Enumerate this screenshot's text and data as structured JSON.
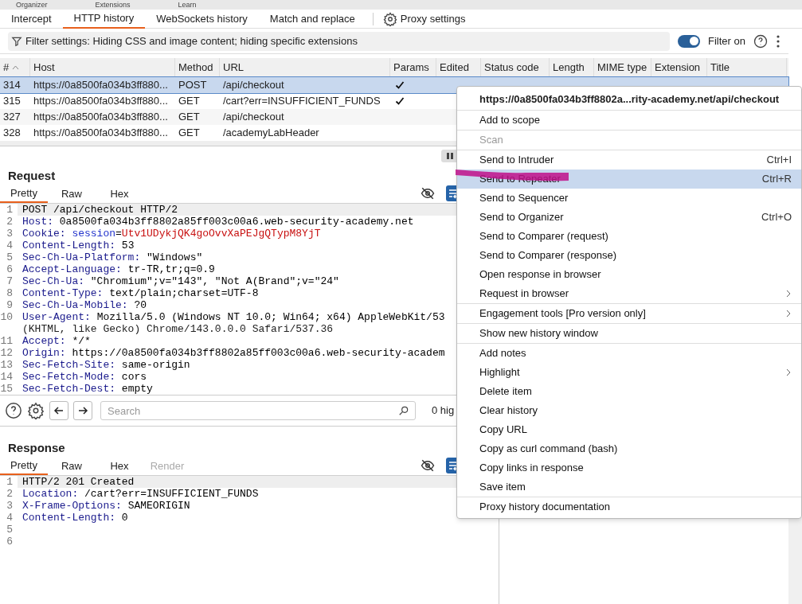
{
  "top_menu": [
    "Organizer",
    "Extensions",
    "Learn"
  ],
  "proxy_tabs": [
    {
      "label": "Intercept",
      "selected": false
    },
    {
      "label": "HTTP history",
      "selected": true
    },
    {
      "label": "WebSockets history",
      "selected": false
    },
    {
      "label": "Match and replace",
      "selected": false
    }
  ],
  "proxy_settings": "Proxy settings",
  "filter": {
    "text": "Filter settings: Hiding CSS and image content; hiding specific extensions",
    "toggle_label": "Filter on",
    "on": true
  },
  "table": {
    "columns": [
      "#",
      "Host",
      "Method",
      "URL",
      "Params",
      "Edited",
      "Status code",
      "Length",
      "MIME type",
      "Extension",
      "Title"
    ],
    "rows": [
      {
        "cells": [
          "314",
          "https://0a8500fa034b3ff880...",
          "POST",
          "/api/checkout"
        ],
        "params": true,
        "selected": true
      },
      {
        "cells": [
          "315",
          "https://0a8500fa034b3ff880...",
          "GET",
          "/cart?err=INSUFFICIENT_FUNDS"
        ],
        "params": true,
        "selected": false
      },
      {
        "cells": [
          "327",
          "https://0a8500fa034b3ff880...",
          "GET",
          "/api/checkout"
        ],
        "params": false,
        "selected": false
      },
      {
        "cells": [
          "328",
          "https://0a8500fa034b3ff880...",
          "GET",
          "/academyLabHeader"
        ],
        "params": false,
        "selected": false
      }
    ]
  },
  "request": {
    "title": "Request",
    "tabs": [
      {
        "label": "Pretty",
        "selected": true
      },
      {
        "label": "Raw",
        "selected": false
      },
      {
        "label": "Hex",
        "selected": false
      }
    ],
    "lines": [
      {
        "no": "1",
        "parts": [
          {
            "kind": "plain",
            "text": "POST /api/checkout HTTP/2"
          }
        ]
      },
      {
        "no": "2",
        "parts": [
          {
            "kind": "name",
            "text": "Host:"
          },
          {
            "kind": "plain",
            "text": " 0a8500fa034b3ff8802a85ff003c00a6.web-security-academy.net"
          }
        ]
      },
      {
        "no": "3",
        "parts": [
          {
            "kind": "name",
            "text": "Cookie:"
          },
          {
            "kind": "cookie-name",
            "text": " session"
          },
          {
            "kind": "plain",
            "text": "="
          },
          {
            "kind": "cookie-value",
            "text": "Utv1UDykjQK4goOvvXaPEJgQTypM8YjT"
          }
        ]
      },
      {
        "no": "4",
        "parts": [
          {
            "kind": "name",
            "text": "Content-Length:"
          },
          {
            "kind": "plain",
            "text": " 53"
          }
        ]
      },
      {
        "no": "5",
        "parts": [
          {
            "kind": "name",
            "text": "Sec-Ch-Ua-Platform:"
          },
          {
            "kind": "plain",
            "text": " \"Windows\""
          }
        ]
      },
      {
        "no": "6",
        "parts": [
          {
            "kind": "name",
            "text": "Accept-Language:"
          },
          {
            "kind": "plain",
            "text": " tr-TR,tr;q=0.9"
          }
        ]
      },
      {
        "no": "7",
        "parts": [
          {
            "kind": "name",
            "text": "Sec-Ch-Ua:"
          },
          {
            "kind": "plain",
            "text": " \"Chromium\";v=\"143\", \"Not A(Brand\";v=\"24\""
          }
        ]
      },
      {
        "no": "8",
        "parts": [
          {
            "kind": "name",
            "text": "Content-Type:"
          },
          {
            "kind": "plain",
            "text": " text/plain;charset=UTF-8"
          }
        ]
      },
      {
        "no": "9",
        "parts": [
          {
            "kind": "name",
            "text": "Sec-Ch-Ua-Mobile:"
          },
          {
            "kind": "plain",
            "text": " ?0"
          }
        ]
      },
      {
        "no": "10",
        "parts": [
          {
            "kind": "name",
            "text": "User-Agent:"
          },
          {
            "kind": "plain",
            "text": " Mozilla/5.0 (Windows NT 10.0; Win64; x64) AppleWebKit/53"
          }
        ],
        "continuation": "(KHTML, like Gecko) Chrome/143.0.0.0 Safari/537.36"
      },
      {
        "no": "11",
        "parts": [
          {
            "kind": "name",
            "text": "Accept:"
          },
          {
            "kind": "plain",
            "text": " */*"
          }
        ]
      },
      {
        "no": "12",
        "parts": [
          {
            "kind": "name",
            "text": "Origin:"
          },
          {
            "kind": "plain",
            "text": " https://0a8500fa034b3ff8802a85ff003c00a6.web-security-academ"
          }
        ]
      },
      {
        "no": "13",
        "parts": [
          {
            "kind": "name",
            "text": "Sec-Fetch-Site:"
          },
          {
            "kind": "plain",
            "text": " same-origin"
          }
        ]
      },
      {
        "no": "14",
        "parts": [
          {
            "kind": "name",
            "text": "Sec-Fetch-Mode:"
          },
          {
            "kind": "plain",
            "text": " cors"
          }
        ]
      },
      {
        "no": "15",
        "parts": [
          {
            "kind": "name",
            "text": "Sec-Fetch-Dest:"
          },
          {
            "kind": "plain",
            "text": " empty"
          }
        ]
      }
    ]
  },
  "search": {
    "placeholder": "Search",
    "highlights": "0 hig"
  },
  "response": {
    "title": "Response",
    "tabs": [
      {
        "label": "Pretty",
        "selected": true,
        "disabled": false
      },
      {
        "label": "Raw",
        "selected": false,
        "disabled": false
      },
      {
        "label": "Hex",
        "selected": false,
        "disabled": false
      },
      {
        "label": "Render",
        "selected": false,
        "disabled": true
      }
    ],
    "lines": [
      {
        "no": "1",
        "parts": [
          {
            "kind": "plain",
            "text": "HTTP/2 201 Created"
          }
        ]
      },
      {
        "no": "2",
        "parts": [
          {
            "kind": "name",
            "text": "Location:"
          },
          {
            "kind": "plain",
            "text": " /cart?err=INSUFFICIENT_FUNDS"
          }
        ]
      },
      {
        "no": "3",
        "parts": [
          {
            "kind": "name",
            "text": "X-Frame-Options:"
          },
          {
            "kind": "plain",
            "text": " SAMEORIGIN"
          }
        ]
      },
      {
        "no": "4",
        "parts": [
          {
            "kind": "name",
            "text": "Content-Length:"
          },
          {
            "kind": "plain",
            "text": " 0"
          }
        ]
      },
      {
        "no": "5"
      },
      {
        "no": "6"
      }
    ]
  },
  "context_menu": {
    "title": "https://0a8500fa034b3ff8802a...rity-academy.net/api/checkout",
    "sections": [
      [
        {
          "label": "Add to scope",
          "disabled": false,
          "selected": false,
          "submenu": false
        }
      ],
      [
        {
          "label": "Scan",
          "disabled": true,
          "selected": false,
          "submenu": false
        }
      ],
      [
        {
          "label": "Send to Intruder",
          "shortcut": "Ctrl+I",
          "disabled": false,
          "selected": false,
          "submenu": false
        },
        {
          "label": "Send to Repeater",
          "shortcut": "Ctrl+R",
          "disabled": false,
          "selected": true,
          "submenu": false
        },
        {
          "label": "Send to Sequencer",
          "disabled": false,
          "selected": false,
          "submenu": false
        },
        {
          "label": "Send to Organizer",
          "shortcut": "Ctrl+O",
          "disabled": false,
          "selected": false,
          "submenu": false
        },
        {
          "label": "Send to Comparer (request)",
          "disabled": false,
          "selected": false,
          "submenu": false
        },
        {
          "label": "Send to Comparer (response)",
          "disabled": false,
          "selected": false,
          "submenu": false
        },
        {
          "label": "Open response in browser",
          "disabled": false,
          "selected": false,
          "submenu": false
        },
        {
          "label": "Request in browser",
          "disabled": false,
          "selected": false,
          "submenu": true
        }
      ],
      [
        {
          "label": "Engagement tools [Pro version only]",
          "disabled": false,
          "selected": false,
          "submenu": true
        }
      ],
      [
        {
          "label": "Show new history window",
          "disabled": false,
          "selected": false,
          "submenu": false
        }
      ],
      [
        {
          "label": "Add notes",
          "disabled": false,
          "selected": false,
          "submenu": false
        },
        {
          "label": "Highlight",
          "disabled": false,
          "selected": false,
          "submenu": true
        },
        {
          "label": "Delete item",
          "disabled": false,
          "selected": false,
          "submenu": false
        },
        {
          "label": "Clear history",
          "disabled": false,
          "selected": false,
          "submenu": false
        },
        {
          "label": "Copy URL",
          "disabled": false,
          "selected": false,
          "submenu": false
        },
        {
          "label": "Copy as curl command (bash)",
          "disabled": false,
          "selected": false,
          "submenu": false
        },
        {
          "label": "Copy links in response",
          "disabled": false,
          "selected": false,
          "submenu": false
        },
        {
          "label": "Save item",
          "disabled": false,
          "selected": false,
          "submenu": false
        }
      ],
      [
        {
          "label": "Proxy history documentation",
          "disabled": false,
          "selected": false,
          "submenu": false
        }
      ]
    ]
  }
}
